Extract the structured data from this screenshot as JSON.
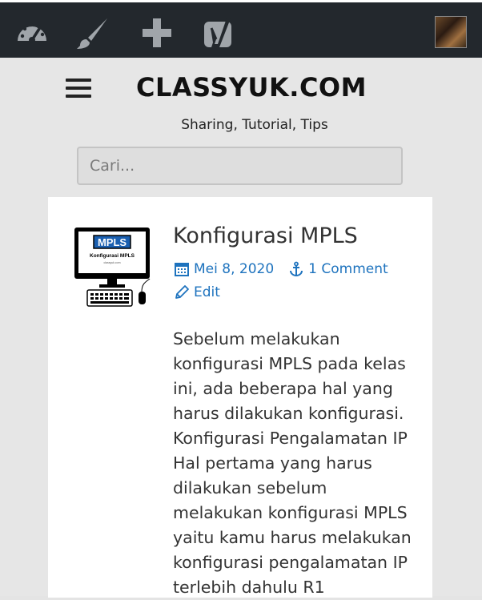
{
  "adminbar": {
    "icons": [
      "dashboard-icon",
      "customize-brush-icon",
      "new-content-plus-icon",
      "yoast-seo-icon"
    ],
    "colors": {
      "background": "#23282d",
      "icon": "#a0a5aa"
    }
  },
  "header": {
    "site_title": "CLASSYUK.COM",
    "tagline": "Sharing, Tutorial, Tips"
  },
  "search": {
    "placeholder": "Cari..."
  },
  "post": {
    "thumbnail": {
      "badge": "MPLS",
      "caption": "Konfigurasi MPLS",
      "footer": "classyuk.com"
    },
    "title": "Konfigurasi MPLS",
    "date": "Mei 8, 2020",
    "comments": "1 Comment",
    "edit": "Edit",
    "excerpt_lines": [
      "Sebelum melakukan",
      "konfigurasi MPLS pada kelas",
      "ini, ada beberapa hal yang",
      "harus dilakukan konfigurasi.",
      "Konfigurasi Pengalamatan IP",
      "Hal pertama yang harus",
      "dilakukan sebelum",
      "melakukan konfigurasi MPLS",
      "yaitu kamu harus melakukan",
      "konfigurasi pengalamatan IP",
      "terlebih dahulu R1"
    ]
  },
  "colors": {
    "link": "#1e73be",
    "page_background": "#e6e6e6"
  }
}
